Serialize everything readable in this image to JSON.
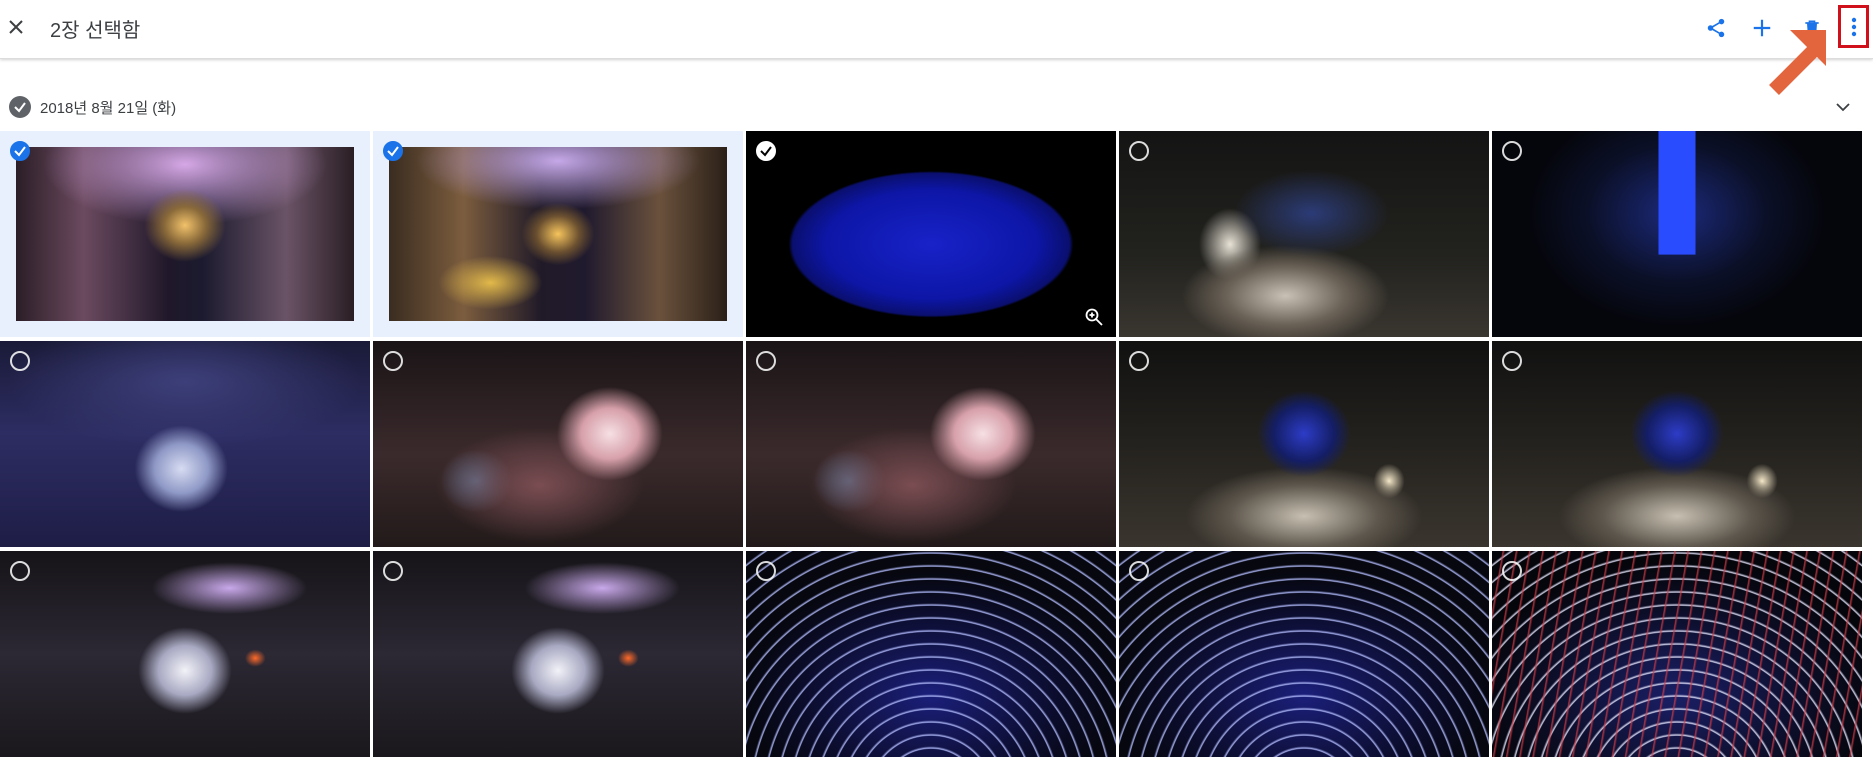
{
  "header": {
    "title": "2장 선택함",
    "actions": [
      "share-icon",
      "add-icon",
      "trash-icon",
      "more-vert-icon"
    ]
  },
  "date_group": {
    "label": "2018년 8월 21일 (화)"
  },
  "colors": {
    "selected_check": "#1a73e8",
    "selected_bg": "#e8f0fe",
    "highlight_box": "#d0101a",
    "annotation_arrow": "#e2653d",
    "action_icon": "#1a73e8"
  },
  "photos": [
    {
      "state": "selected"
    },
    {
      "state": "selected"
    },
    {
      "state": "hover-checked"
    },
    {
      "state": "unselected"
    },
    {
      "state": "unselected"
    },
    {
      "state": "unselected"
    },
    {
      "state": "unselected"
    },
    {
      "state": "unselected"
    },
    {
      "state": "unselected"
    },
    {
      "state": "unselected"
    },
    {
      "state": "unselected"
    },
    {
      "state": "unselected"
    },
    {
      "state": "unselected"
    },
    {
      "state": "unselected"
    },
    {
      "state": "unselected"
    }
  ]
}
